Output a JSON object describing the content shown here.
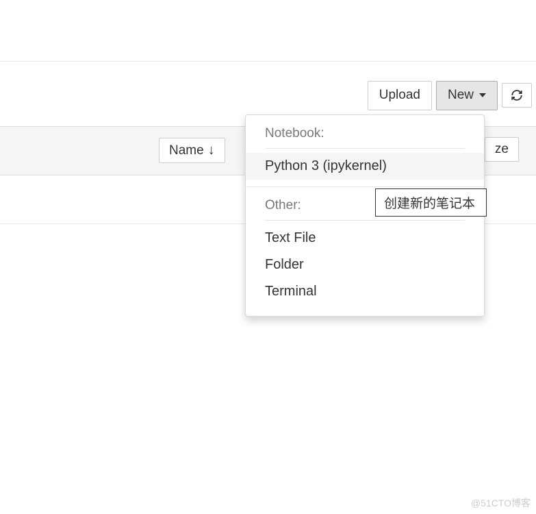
{
  "toolbar": {
    "upload_label": "Upload",
    "new_label": "New",
    "refresh_title": "Refresh"
  },
  "list_header": {
    "sort_name_label": "Name",
    "size_label": "ze"
  },
  "dropdown": {
    "section_notebook": "Notebook:",
    "items_notebook": [
      {
        "label": "Python 3 (ipykernel)"
      }
    ],
    "section_other": "Other:",
    "items_other": [
      {
        "label": "Text File"
      },
      {
        "label": "Folder"
      },
      {
        "label": "Terminal"
      }
    ]
  },
  "tooltip": {
    "text": "创建新的笔记本 "
  },
  "watermark": "@51CTO博客"
}
